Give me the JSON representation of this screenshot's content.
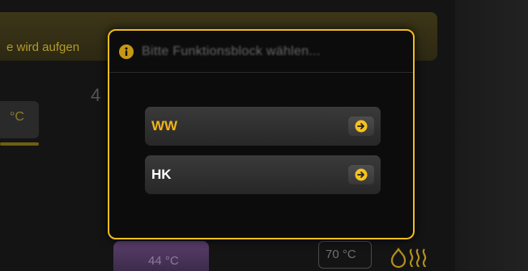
{
  "background": {
    "message": "e wird aufgen",
    "temp_left": "°C",
    "number_partial": "4",
    "temp_bottom": "44 °C",
    "temp_right": "70 °C"
  },
  "dialog": {
    "title": "Bitte Funktionsblock wählen...",
    "options": [
      {
        "label": "WW",
        "color": "#f2b318"
      },
      {
        "label": "HK",
        "color": "#ffffff"
      }
    ]
  },
  "colors": {
    "accent": "#f2bc1b",
    "arrow_icon": "#f7c21e"
  }
}
